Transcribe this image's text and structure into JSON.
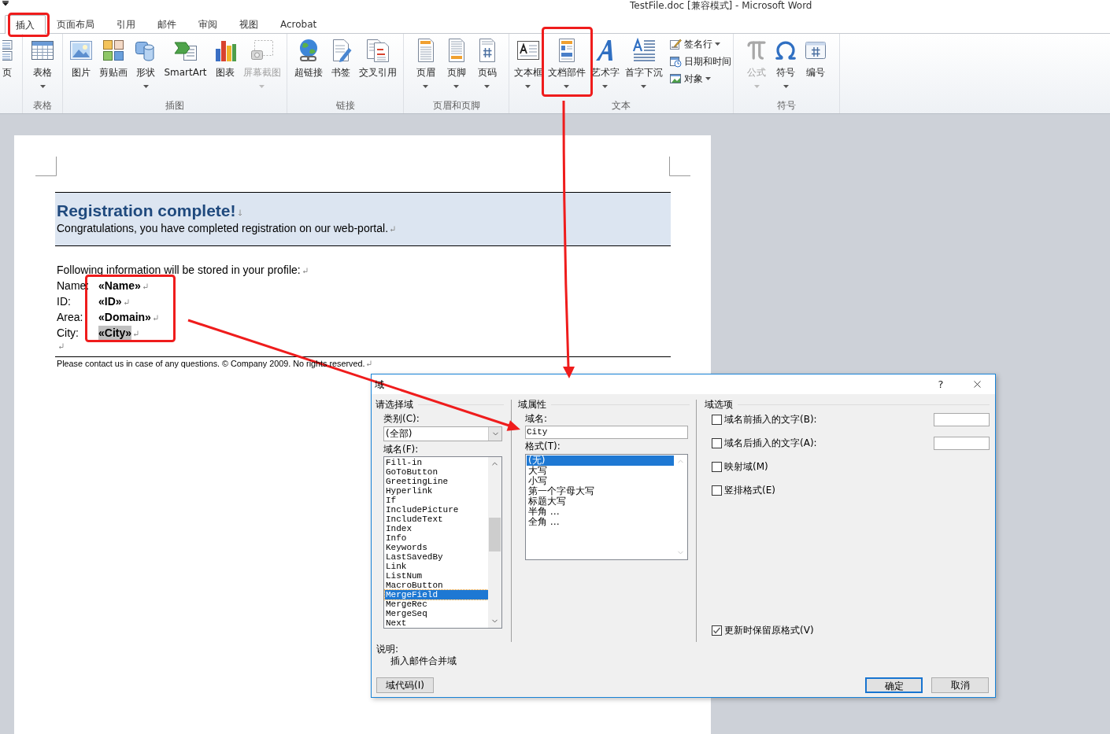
{
  "window": {
    "title": "TestFile.doc [兼容模式] - Microsoft Word"
  },
  "ribbon": {
    "tabs": [
      {
        "label": "插入",
        "selected": true
      },
      {
        "label": "页面布局",
        "selected": false
      },
      {
        "label": "引用",
        "selected": false
      },
      {
        "label": "邮件",
        "selected": false
      },
      {
        "label": "审阅",
        "selected": false
      },
      {
        "label": "视图",
        "selected": false
      },
      {
        "label": "Acrobat",
        "selected": false
      }
    ],
    "groups": [
      {
        "buttons": [
          {
            "label": "页",
            "dropdown": false,
            "disabled": false
          }
        ]
      },
      {
        "label": "表格",
        "buttons": [
          {
            "label": "表格",
            "dropdown": true,
            "disabled": false
          }
        ]
      },
      {
        "label": "插图",
        "buttons": [
          {
            "label": "图片",
            "dropdown": false,
            "disabled": false
          },
          {
            "label": "剪贴画",
            "dropdown": false,
            "disabled": false
          },
          {
            "label": "形状",
            "dropdown": true,
            "disabled": false
          },
          {
            "label": "SmartArt",
            "dropdown": false,
            "disabled": false
          },
          {
            "label": "图表",
            "dropdown": false,
            "disabled": false
          },
          {
            "label": "屏幕截图",
            "dropdown": true,
            "disabled": true
          }
        ]
      },
      {
        "label": "链接",
        "buttons": [
          {
            "label": "超链接",
            "dropdown": false,
            "disabled": false
          },
          {
            "label": "书签",
            "dropdown": false,
            "disabled": false
          },
          {
            "label": "交叉引用",
            "dropdown": false,
            "disabled": false
          }
        ]
      },
      {
        "label": "页眉和页脚",
        "buttons": [
          {
            "label": "页眉",
            "dropdown": true,
            "disabled": false
          },
          {
            "label": "页脚",
            "dropdown": true,
            "disabled": false
          },
          {
            "label": "页码",
            "dropdown": true,
            "disabled": false
          }
        ]
      },
      {
        "label": "文本",
        "buttons": [
          {
            "label": "文本框",
            "dropdown": true,
            "disabled": false
          },
          {
            "label": "文档部件",
            "dropdown": true,
            "disabled": false
          },
          {
            "label": "艺术字",
            "dropdown": true,
            "disabled": false
          },
          {
            "label": "首字下沉",
            "dropdown": true,
            "disabled": false
          }
        ],
        "small_buttons": [
          {
            "label": "签名行",
            "dropdown": true
          },
          {
            "label": "日期和时间",
            "dropdown": false
          },
          {
            "label": "对象",
            "dropdown": true
          }
        ]
      },
      {
        "label": "符号",
        "buttons": [
          {
            "label": "公式",
            "dropdown": true,
            "disabled": true
          },
          {
            "label": "符号",
            "dropdown": true,
            "disabled": false
          },
          {
            "label": "编号",
            "dropdown": false,
            "disabled": false
          }
        ]
      }
    ]
  },
  "document": {
    "title": "Registration complete!",
    "subtitle": "Congratulations, you have completed registration on our web-portal.",
    "intro": "Following information will be stored in your profile:",
    "fields": [
      {
        "label": "Name:",
        "value": "«Name»",
        "selected": false
      },
      {
        "label": "ID:",
        "value": "«ID»",
        "selected": false
      },
      {
        "label": "Area:",
        "value": "«Domain»",
        "selected": false
      },
      {
        "label": "City:",
        "value": "«City»",
        "selected": true
      }
    ],
    "footer": "Please contact us in case of any questions. © Company 2009. No rights reserved."
  },
  "dialog": {
    "title": "域",
    "help_button": "?",
    "select_field": {
      "heading": "请选择域",
      "category_label": "类别(C):",
      "category_value": "(全部)",
      "names_label": "域名(F):",
      "names": [
        {
          "label": "Fill-in",
          "selected": false
        },
        {
          "label": "GoToButton",
          "selected": false
        },
        {
          "label": "GreetingLine",
          "selected": false
        },
        {
          "label": "Hyperlink",
          "selected": false
        },
        {
          "label": "If",
          "selected": false
        },
        {
          "label": "IncludePicture",
          "selected": false
        },
        {
          "label": "IncludeText",
          "selected": false
        },
        {
          "label": "Index",
          "selected": false
        },
        {
          "label": "Info",
          "selected": false
        },
        {
          "label": "Keywords",
          "selected": false
        },
        {
          "label": "LastSavedBy",
          "selected": false
        },
        {
          "label": "Link",
          "selected": false
        },
        {
          "label": "ListNum",
          "selected": false
        },
        {
          "label": "MacroButton",
          "selected": false
        },
        {
          "label": "MergeField",
          "selected": true
        },
        {
          "label": "MergeRec",
          "selected": false
        },
        {
          "label": "MergeSeq",
          "selected": false
        },
        {
          "label": "Next",
          "selected": false
        }
      ]
    },
    "field_properties": {
      "heading": "域属性",
      "name_label": "域名:",
      "name_value": "City",
      "format_label": "格式(T):",
      "formats": [
        {
          "label": "(无)",
          "selected": true
        },
        {
          "label": "大写",
          "selected": false
        },
        {
          "label": "小写",
          "selected": false
        },
        {
          "label": "第一个字母大写",
          "selected": false
        },
        {
          "label": "标题大写",
          "selected": false
        },
        {
          "label": "半角 …",
          "selected": false
        },
        {
          "label": "全角 …",
          "selected": false
        }
      ]
    },
    "field_options": {
      "heading": "域选项",
      "options": [
        {
          "kind": "with_text",
          "label": "域名前插入的文字(B):",
          "checked": false
        },
        {
          "kind": "with_text",
          "label": "域名后插入的文字(A):",
          "checked": false
        },
        {
          "kind": "checkbox",
          "label": "映射域(M)",
          "checked": false
        },
        {
          "kind": "checkbox",
          "label": "竖排格式(E)",
          "checked": false
        }
      ],
      "preserve_formatting": {
        "label": "更新时保留原格式(V)",
        "checked": true
      }
    },
    "description_label": "说明:",
    "description": "插入邮件合并域",
    "field_codes_button": "域代码(I)",
    "buttons": [
      {
        "label": "确定",
        "default": true
      },
      {
        "label": "取消",
        "default": false
      }
    ]
  }
}
